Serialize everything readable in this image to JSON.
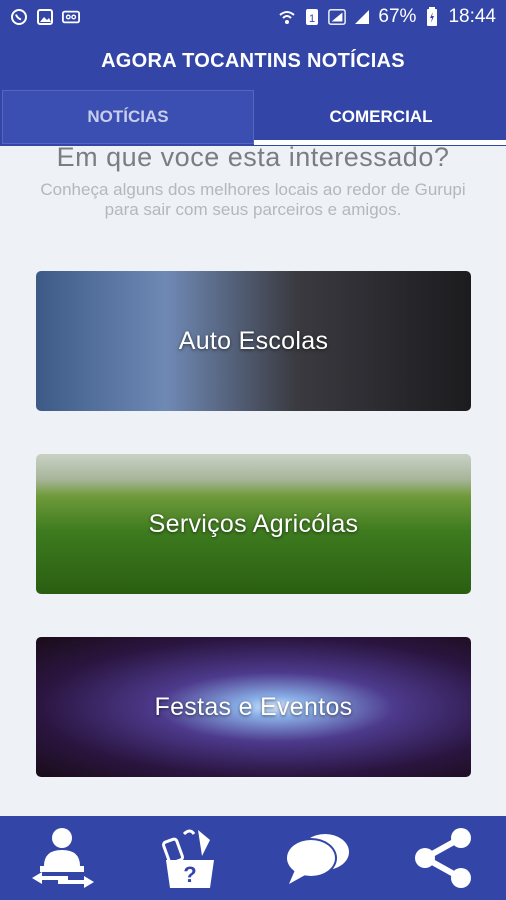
{
  "status_bar": {
    "battery": "67%",
    "time": "18:44"
  },
  "app": {
    "title": "AGORA TOCANTINS NOTÍCIAS"
  },
  "tabs": [
    {
      "label": "NOTÍCIAS",
      "active": false
    },
    {
      "label": "COMERCIAL",
      "active": true
    }
  ],
  "content": {
    "headline": "Em que voce esta interessado?",
    "subtitle": "Conheça alguns dos melhores locais ao redor de Gurupi para sair com seus parceiros e amigos."
  },
  "categories": [
    {
      "label": "Auto Escolas"
    },
    {
      "label": "Serviços Agricólas"
    },
    {
      "label": "Festas e Eventos"
    }
  ],
  "bottom_nav": [
    {
      "icon": "user-transfer-icon"
    },
    {
      "icon": "help-box-icon"
    },
    {
      "icon": "chat-icon"
    },
    {
      "icon": "share-icon"
    }
  ],
  "colors": {
    "primary": "#3346a8",
    "background": "#eef1f5"
  }
}
